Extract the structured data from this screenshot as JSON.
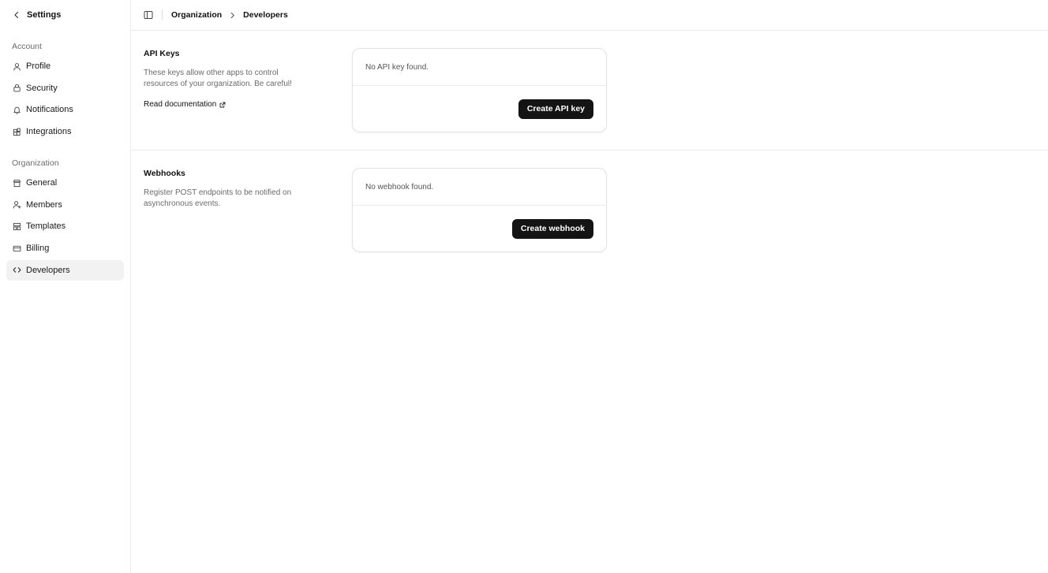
{
  "sidebar": {
    "title": "Settings",
    "groups": [
      {
        "label": "Account",
        "items": [
          {
            "label": "Profile",
            "icon": "user-icon"
          },
          {
            "label": "Security",
            "icon": "lock-icon"
          },
          {
            "label": "Notifications",
            "icon": "bell-icon"
          },
          {
            "label": "Integrations",
            "icon": "puzzle-icon"
          }
        ]
      },
      {
        "label": "Organization",
        "items": [
          {
            "label": "General",
            "icon": "store-icon"
          },
          {
            "label": "Members",
            "icon": "users-icon"
          },
          {
            "label": "Templates",
            "icon": "layout-icon"
          },
          {
            "label": "Billing",
            "icon": "credit-card-icon"
          },
          {
            "label": "Developers",
            "icon": "code-icon",
            "active": true
          }
        ]
      }
    ]
  },
  "breadcrumb": {
    "items": [
      "Organization",
      "Developers"
    ]
  },
  "sections": {
    "api_keys": {
      "title": "API Keys",
      "description": "These keys allow other apps to control resources of your organization. Be careful!",
      "link_label": "Read documentation",
      "empty_text": "No API key found.",
      "button_label": "Create API key"
    },
    "webhooks": {
      "title": "Webhooks",
      "description": "Register POST endpoints to be notified on asynchronous events.",
      "empty_text": "No webhook found.",
      "button_label": "Create webhook"
    }
  },
  "colors": {
    "button_bg": "#141414",
    "active_item_bg": "#f2f2f2",
    "border": "#ececec",
    "muted_text": "#6b6b6b"
  }
}
